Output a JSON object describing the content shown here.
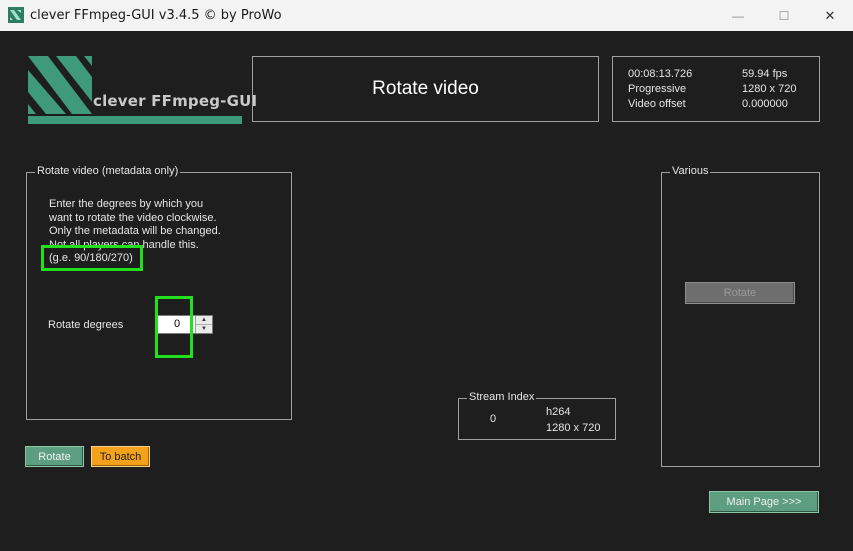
{
  "window": {
    "title": "clever FFmpeg-GUI v3.4.5   © by ProWo",
    "controls": {
      "minimize": "—",
      "maximize": "☐",
      "close": "✕"
    }
  },
  "logo": {
    "text": "clever FFmpeg-GUI"
  },
  "header": {
    "title": "Rotate video"
  },
  "info": {
    "duration": "00:08:13.726",
    "fps": "59.94 fps",
    "scan": "Progressive",
    "resolution": "1280 x 720",
    "video_offset_label": "Video offset",
    "video_offset_value": "0.000000"
  },
  "rotate_group": {
    "label": "Rotate video (metadata only)",
    "description": [
      "Enter the degrees by which you",
      "want to rotate the video clockwise.",
      "Only the metadata will be changed.",
      "Not all players can handle this."
    ],
    "hint": "(g.e. 90/180/270)",
    "degrees_label": "Rotate degrees",
    "degrees_value": "0"
  },
  "various_group": {
    "label": "Various",
    "rotate_button": "Rotate"
  },
  "stream_group": {
    "label": "Stream Index",
    "index": "0",
    "codec": "h264",
    "resolution": "1280 x 720"
  },
  "buttons": {
    "rotate": "Rotate",
    "to_batch": "To batch",
    "main_page": "Main Page >>>"
  },
  "colors": {
    "background": "#1e1e1e",
    "button_green": "#5e9e80",
    "button_orange": "#f4a21c",
    "highlight": "#22e01e",
    "logo_green": "#3e9a7a"
  }
}
